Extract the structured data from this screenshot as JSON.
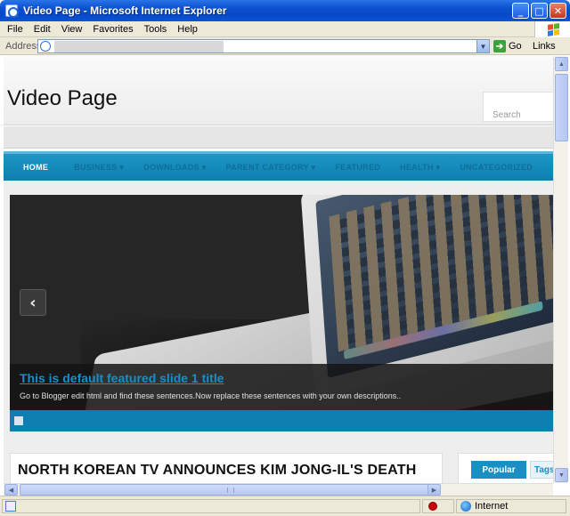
{
  "window": {
    "title": "Video Page - Microsoft Internet Explorer",
    "minimize": "_",
    "maximize": "□",
    "close": "✕"
  },
  "menu": [
    "File",
    "Edit",
    "View",
    "Favorites",
    "Tools",
    "Help"
  ],
  "address_bar": {
    "label": "Address",
    "url": "",
    "go_label": "Go",
    "links_label": "Links"
  },
  "site": {
    "title": "Video Page",
    "search_label": "Search"
  },
  "nav": {
    "items": [
      "HOME",
      "BUSINESS ▾",
      "DOWNLOADS ▾",
      "PARENT CATEGORY ▾",
      "FEATURED",
      "HEALTH ▾",
      "UNCATEGORIZED"
    ]
  },
  "slider": {
    "prev_glyph": "‹",
    "slide_title": "This is default featured slide 1 title",
    "slide_description": "Go to Blogger edit html and find these sentences.Now replace these sentences with your own descriptions.."
  },
  "post": {
    "title": "NORTH KOREAN TV ANNOUNCES KIM JONG-IL'S DEATH"
  },
  "sidebar": {
    "tabs": [
      "Popular",
      "Tags"
    ]
  },
  "status": {
    "zone": "Internet"
  },
  "colors": {
    "nav_bar": "#0d7fb0",
    "accent": "#1a8fc4",
    "titlebar": "#0a4fd0"
  }
}
